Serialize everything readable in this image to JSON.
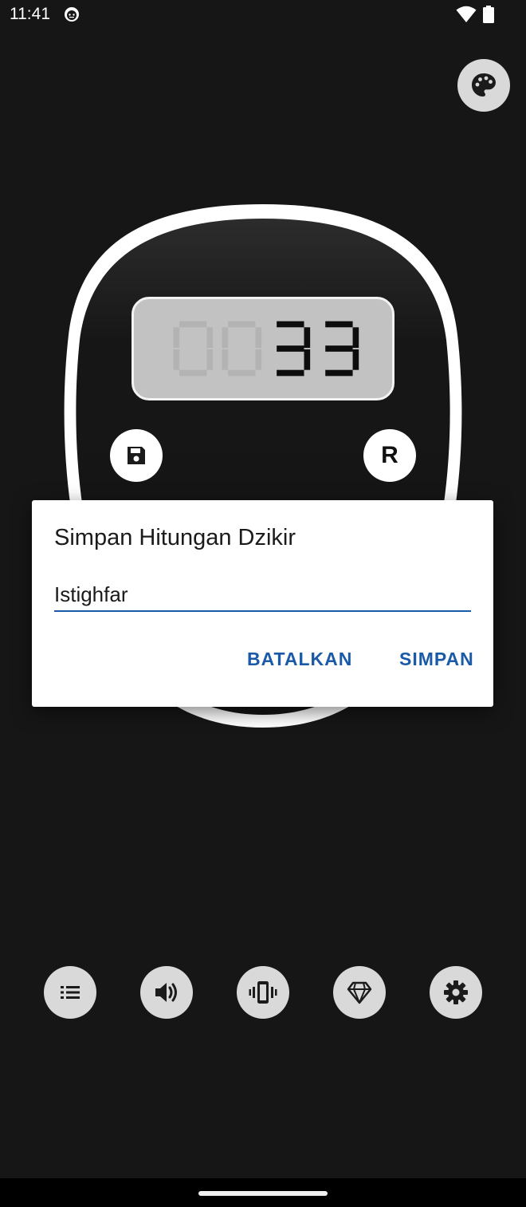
{
  "status_bar": {
    "time": "11:41",
    "app_icon": "face-icon",
    "wifi_icon": "wifi-icon",
    "battery_icon": "battery-icon"
  },
  "header": {
    "palette_icon": "palette-icon"
  },
  "counter": {
    "display_value": "0033",
    "save_icon": "floppy-disk-icon",
    "reset_label": "R"
  },
  "dialog": {
    "title": "Simpan Hitungan Dzikir",
    "input_value": "Istighfar",
    "cancel_label": "BATALKAN",
    "save_label": "SIMPAN"
  },
  "toolbar": {
    "items": [
      {
        "icon": "list-icon"
      },
      {
        "icon": "volume-icon"
      },
      {
        "icon": "vibrate-icon"
      },
      {
        "icon": "diamond-icon"
      },
      {
        "icon": "gear-icon"
      }
    ]
  },
  "colors": {
    "background": "#161616",
    "accent": "#1a5aa8",
    "button_light": "#d9d9d9",
    "lcd": "#c2c2c2"
  }
}
